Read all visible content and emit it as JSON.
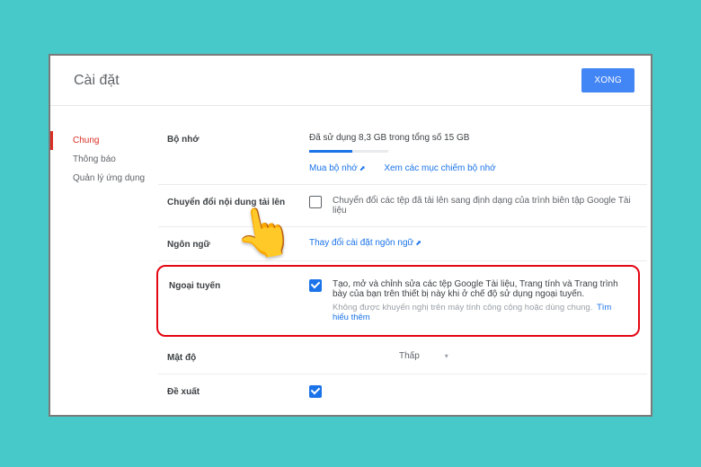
{
  "dialog": {
    "title": "Cài đặt",
    "done": "XONG"
  },
  "sidebar": {
    "items": [
      {
        "label": "Chung"
      },
      {
        "label": "Thông báo"
      },
      {
        "label": "Quản lý ứng dụng"
      }
    ]
  },
  "storage": {
    "label": "Bộ nhớ",
    "usage_text": "Đã sử dụng 8,3 GB trong tổng số 15 GB",
    "buy_link": "Mua bộ nhớ",
    "view_link": "Xem các mục chiếm bộ nhớ"
  },
  "convert": {
    "label": "Chuyển đổi nội dung tải lên",
    "desc": "Chuyển đổi các tệp đã tải lên sang định dạng của trình biên tập Google Tài liệu"
  },
  "language": {
    "label": "Ngôn ngữ",
    "link": "Thay đổi cài đặt ngôn ngữ"
  },
  "offline": {
    "label": "Ngoại tuyến",
    "desc": "Tạo, mở và chỉnh sửa các tệp Google Tài liệu, Trang tính và Trang trình bày của bạn trên thiết bị này khi ở chế độ sử dụng ngoại tuyến.",
    "sub": "Không được khuyến nghị trên máy tính công cộng hoặc dùng chung.",
    "learn": "Tìm hiểu thêm"
  },
  "density": {
    "label": "Mật độ",
    "value": "Thấp"
  },
  "suggest": {
    "label": "Đề xuất"
  }
}
